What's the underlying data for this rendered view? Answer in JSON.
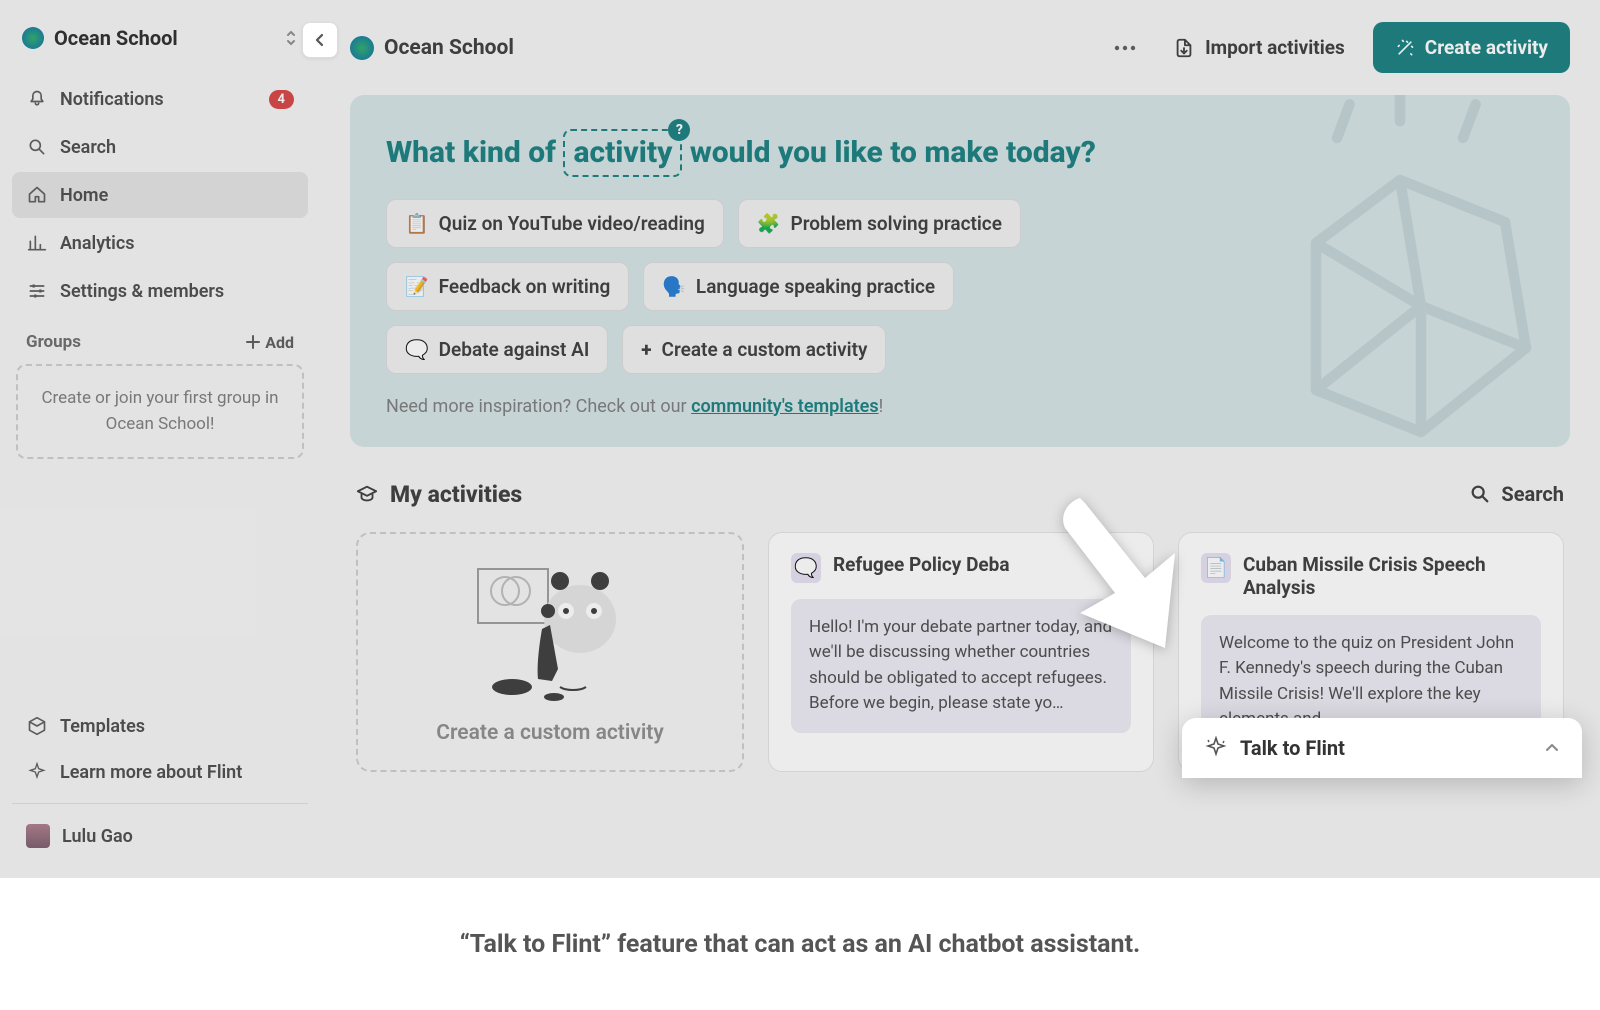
{
  "sidebar": {
    "school_name": "Ocean School",
    "nav": {
      "notifications": {
        "label": "Notifications",
        "badge": "4"
      },
      "search": {
        "label": "Search"
      },
      "home": {
        "label": "Home"
      },
      "analytics": {
        "label": "Analytics"
      },
      "settings": {
        "label": "Settings & members"
      }
    },
    "groups_label": "Groups",
    "add_label": "Add",
    "groups_empty": "Create or join your first group in Ocean School!",
    "templates": "Templates",
    "learn_more": "Learn more about Flint",
    "user_name": "Lulu Gao"
  },
  "topbar": {
    "title": "Ocean School",
    "import": "Import activities",
    "create": "Create activity"
  },
  "hero": {
    "prefix": "What kind of ",
    "highlight": "activity",
    "suffix": " would you like to make today?",
    "badge": "?",
    "chips": [
      {
        "emoji": "📋",
        "label": "Quiz on YouTube video/reading"
      },
      {
        "emoji": "🧩",
        "label": "Problem solving practice"
      },
      {
        "emoji": "📝",
        "label": "Feedback on writing"
      },
      {
        "emoji": "🗣️",
        "label": "Language speaking practice"
      },
      {
        "emoji": "🗨️",
        "label": "Debate against AI"
      },
      {
        "emoji": "+",
        "label": "Create a custom activity"
      }
    ],
    "inspiration_prefix": "Need more inspiration? Check out our ",
    "inspiration_link": "community's templates",
    "inspiration_suffix": "!"
  },
  "activities": {
    "title": "My activities",
    "search_label": "Search",
    "create_card_label": "Create a custom activity",
    "cards": [
      {
        "title": "Refugee Policy Deba",
        "body": "Hello! I'm your debate partner today, and we'll be discussing whether countries should be obligated to accept refugees. Before we begin, please state yo…"
      },
      {
        "title": "Cuban Missile Crisis Speech Analysis",
        "body": "Welcome to the quiz on President John F. Kennedy's speech during the Cuban Missile Crisis! We'll explore the key elements and"
      }
    ]
  },
  "flint_widget": {
    "title": "Talk to Flint"
  },
  "caption": "“Talk to Flint” feature that can act as an AI chatbot assistant."
}
